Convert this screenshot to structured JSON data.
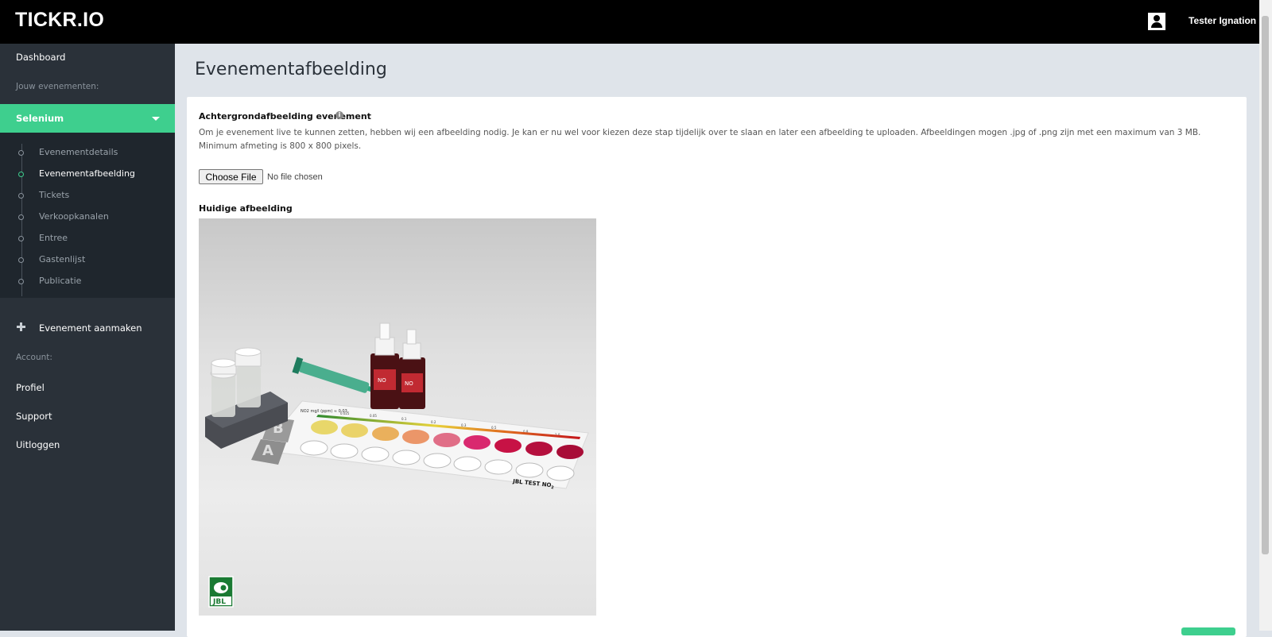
{
  "header": {
    "logo": "TICKR.IO",
    "user_name": "Tester Ignation"
  },
  "sidebar": {
    "dashboard": "Dashboard",
    "events_heading": "Jouw evenementen:",
    "event_name": "Selenium",
    "sub_items": [
      {
        "label": "Evenementdetails",
        "active": false
      },
      {
        "label": "Evenementafbeelding",
        "active": true
      },
      {
        "label": "Tickets",
        "active": false
      },
      {
        "label": "Verkoopkanalen",
        "active": false
      },
      {
        "label": "Entree",
        "active": false
      },
      {
        "label": "Gastenlijst",
        "active": false
      },
      {
        "label": "Publicatie",
        "active": false
      }
    ],
    "create_event": "Evenement aanmaken",
    "account_heading": "Account:",
    "profile": "Profiel",
    "support": "Support",
    "logout": "Uitloggen"
  },
  "main": {
    "page_title": "Evenementafbeelding",
    "bg_label": "Achtergrondafbeelding evenement",
    "help_text": "Om je evenement live te kunnen zetten, hebben wij een afbeelding nodig. Je kan er nu wel voor kiezen deze stap tijdelijk over te slaan en later een afbeelding te uploaden. Afbeeldingen mogen .jpg of .png zijn met een maximum van 3 MB. Minimum afmeting is 800 x 800 pixels.",
    "file_button": "Choose File",
    "file_status": "No file chosen",
    "current_image_label": "Huidige afbeelding"
  },
  "image": {
    "caption": "JBL TEST NO",
    "subscript": "2",
    "logo_text": "JBL",
    "bottle_label": "NO",
    "legend": "NO2 mg/l (ppm) ≈ 0.03",
    "letters": [
      "B",
      "A"
    ],
    "scale_labels": [
      "0.025",
      "0.05",
      "0.1",
      "0.2",
      "0.3",
      "0.5",
      "0.8",
      "1.0"
    ]
  },
  "colors": {
    "accent": "#3ecf8e",
    "sidebar_bg": "#2a3139",
    "topbar_bg": "#000000"
  }
}
